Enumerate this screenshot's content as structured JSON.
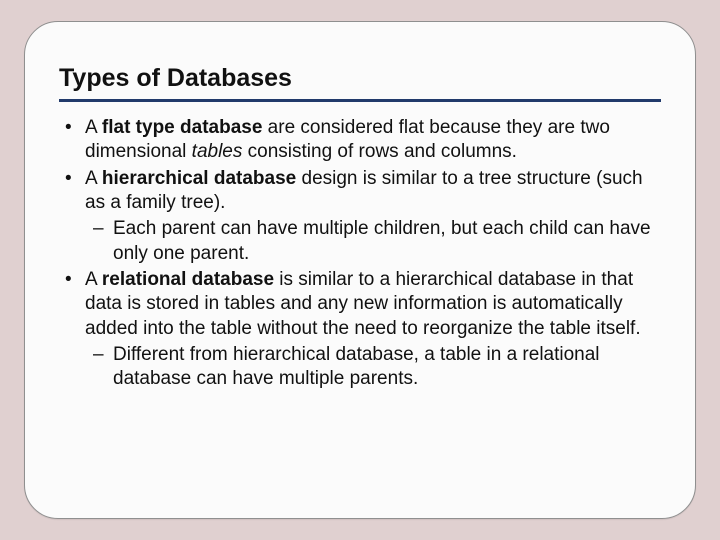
{
  "title": "Types of Databases",
  "bullets": [
    {
      "pre": "A ",
      "bold": "flat type database",
      "post1": " are considered flat because they are two dimensional ",
      "italic": "tables",
      "post2": " consisting of rows and columns.",
      "sub": []
    },
    {
      "pre": "A ",
      "bold": "hierarchical database",
      "post1": " design is similar to a tree structure (such as a family tree).",
      "italic": "",
      "post2": "",
      "sub": [
        "Each parent can have multiple children, but each child can have only one parent."
      ]
    },
    {
      "pre": "A ",
      "bold": "relational database",
      "post1": " is similar to a hierarchical database in that data is stored in tables and any new information is automatically added into the table without the need to reorganize the table itself.",
      "italic": "",
      "post2": "",
      "sub": [
        "Different from hierarchical database, a table in a relational database can have multiple parents."
      ]
    }
  ]
}
